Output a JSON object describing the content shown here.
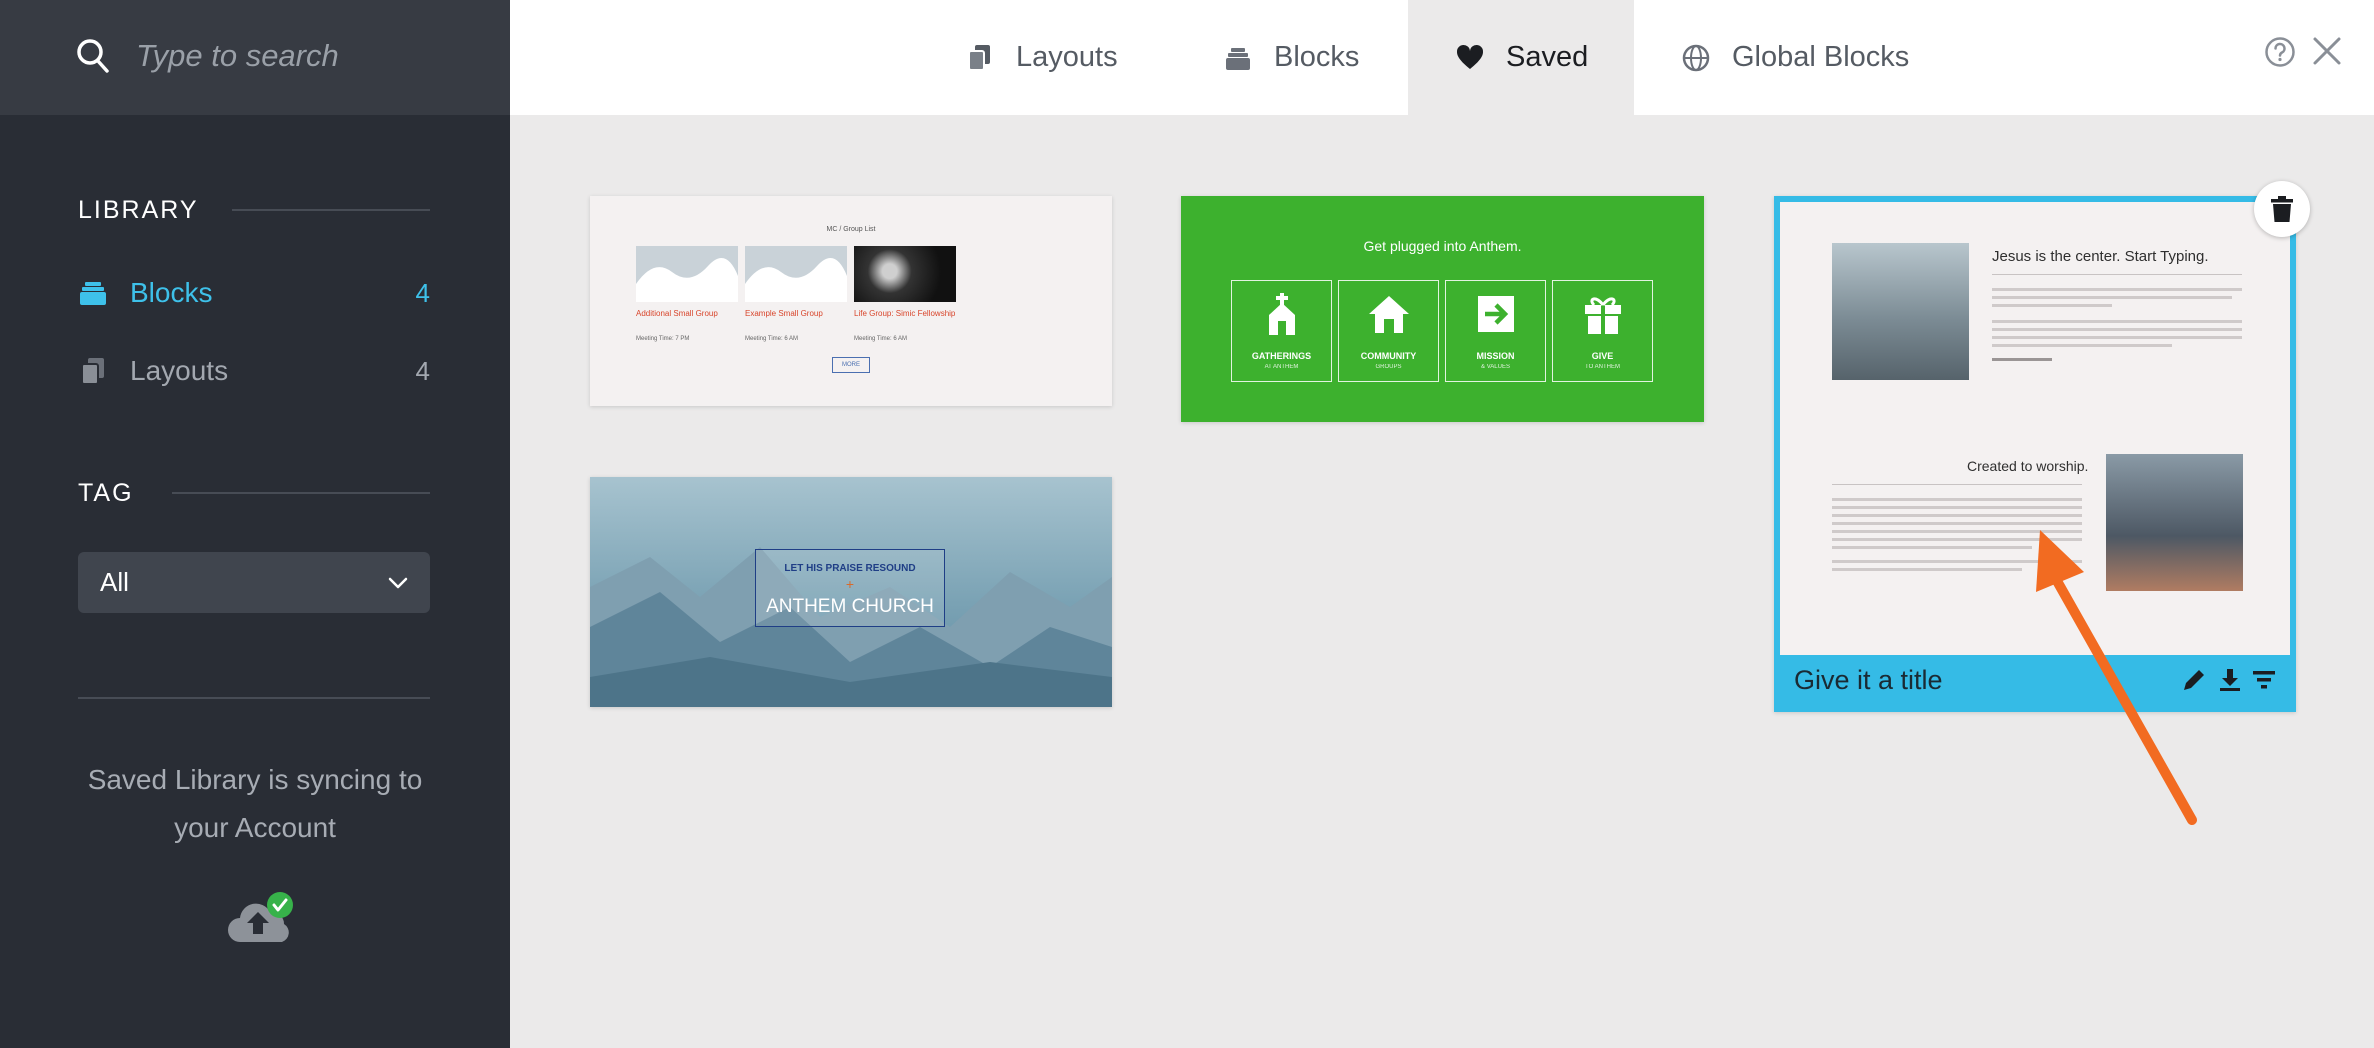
{
  "search": {
    "placeholder": "Type to search",
    "icon": "search-icon"
  },
  "sidebar": {
    "library_heading": "LIBRARY",
    "items": [
      {
        "label": "Blocks",
        "count": "4",
        "icon": "blocks-icon",
        "active": true
      },
      {
        "label": "Layouts",
        "count": "4",
        "icon": "layouts-icon",
        "active": false
      }
    ],
    "tag_heading": "TAG",
    "tag_select": {
      "value": "All"
    },
    "sync_text": "Saved Library is syncing to your Account"
  },
  "tabs": [
    {
      "label": "Layouts",
      "icon": "layouts-icon",
      "active": false
    },
    {
      "label": "Blocks",
      "icon": "blocks-icon",
      "active": false
    },
    {
      "label": "Saved",
      "icon": "heart-icon",
      "active": true
    },
    {
      "label": "Global Blocks",
      "icon": "globe-icon",
      "active": false
    }
  ],
  "cards": {
    "group_list": {
      "heading": "MC / Group List",
      "groups": [
        {
          "name": "Additional Small Group",
          "detail": "Meeting Time: 7 PM"
        },
        {
          "name": "Example Small Group",
          "detail": "Meeting Time: 6 AM"
        },
        {
          "name": "Life Group: Simic Fellowship",
          "detail": "Meeting Time: 6 AM"
        }
      ],
      "button": "MORE"
    },
    "plugged_in": {
      "heading": "Get plugged into Anthem.",
      "boxes": [
        {
          "title": "GATHERINGS",
          "sub": "AT ANTHEM",
          "icon": "church-icon"
        },
        {
          "title": "COMMUNITY",
          "sub": "GROUPS",
          "icon": "home-icon"
        },
        {
          "title": "MISSION",
          "sub": "& VALUES",
          "icon": "arrow-box-icon"
        },
        {
          "title": "GIVE",
          "sub": "TO ANTHEM",
          "icon": "gift-icon"
        }
      ]
    },
    "hero": {
      "line1": "LET HIS PRAISE RESOUND",
      "plus": "+",
      "line2": "ANTHEM CHURCH"
    },
    "selected": {
      "heading1": "Jesus is the center. Start Typing.",
      "heading2": "Created to worship.",
      "title": "Give it a title",
      "actions": [
        "edit-icon",
        "download-icon",
        "filter-icon"
      ],
      "delete_icon": "trash-icon"
    }
  },
  "colors": {
    "sidebar_bg": "#292d35",
    "accent": "#3ec1ea",
    "selected_border": "#35bbe6",
    "green_card": "#3db12e",
    "annotation_arrow": "#f26b21"
  }
}
